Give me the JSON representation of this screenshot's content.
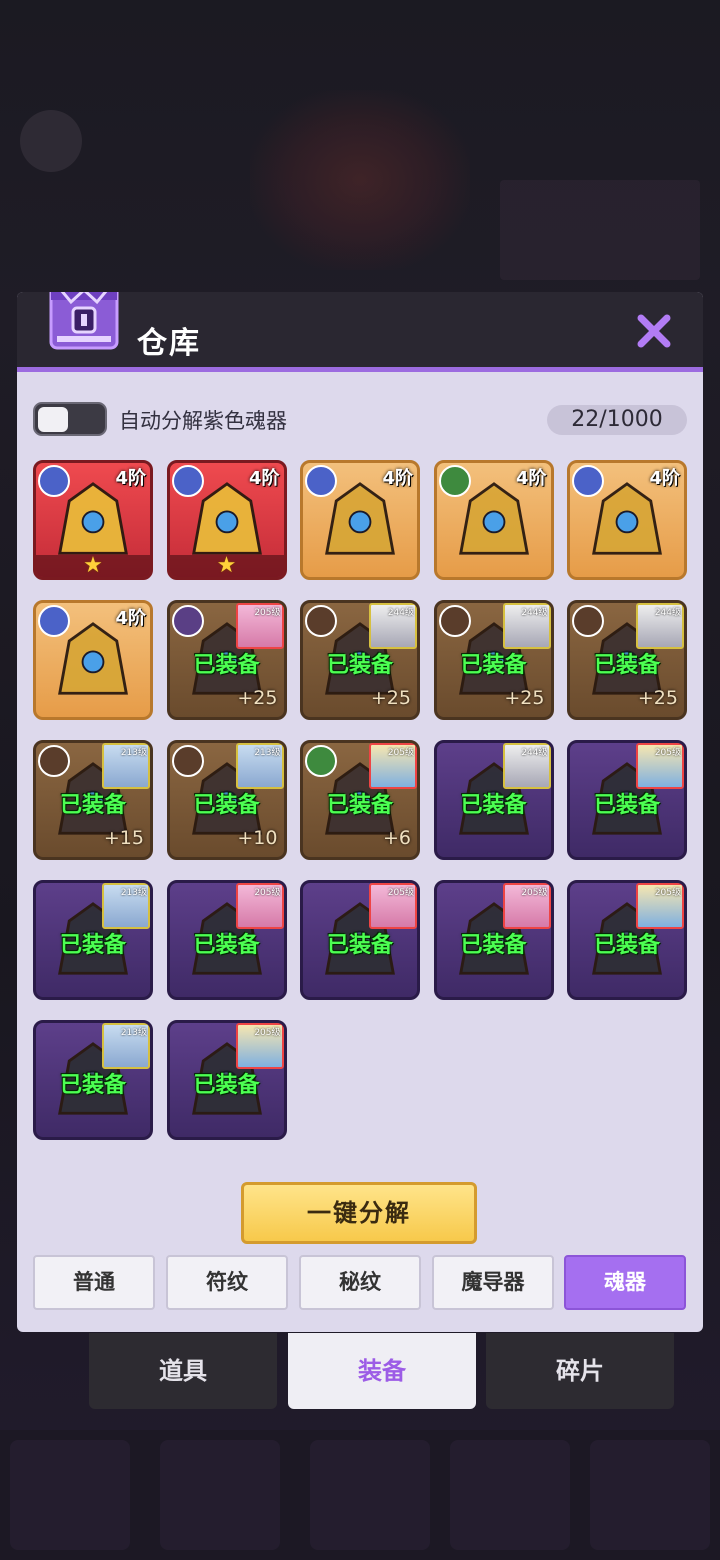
{
  "header": {
    "title": "仓库"
  },
  "toggle": {
    "label": "自动分解紫色魂器",
    "on": false
  },
  "capacity": "22/1000",
  "items": [
    {
      "tier": "4阶",
      "bg": "red",
      "badge": "blue",
      "star": true
    },
    {
      "tier": "4阶",
      "bg": "red",
      "badge": "blue",
      "star": true
    },
    {
      "tier": "4阶",
      "bg": "orange",
      "badge": "blue"
    },
    {
      "tier": "4阶",
      "bg": "orange",
      "badge": "green"
    },
    {
      "tier": "4阶",
      "bg": "orange",
      "badge": "blue"
    },
    {
      "tier": "4阶",
      "bg": "orange",
      "badge": "blue"
    },
    {
      "bg": "brown",
      "badge": "violet",
      "equipped": "已装备",
      "enh": "+25",
      "hero_level": "205级",
      "hero": "pink"
    },
    {
      "bg": "brown",
      "badge": "dark",
      "equipped": "已装备",
      "enh": "+25",
      "hero_level": "244级",
      "hero": "white"
    },
    {
      "bg": "brown",
      "badge": "dark",
      "equipped": "已装备",
      "enh": "+25",
      "hero_level": "244级",
      "hero": "white"
    },
    {
      "bg": "brown",
      "badge": "dark",
      "equipped": "已装备",
      "enh": "+25",
      "hero_level": "244级",
      "hero": "white"
    },
    {
      "bg": "brown",
      "badge": "dark",
      "equipped": "已装备",
      "enh": "+15",
      "hero_level": "213级",
      "hero": "blue"
    },
    {
      "bg": "brown",
      "badge": "dark",
      "equipped": "已装备",
      "enh": "+10",
      "hero_level": "213级",
      "hero": "blue"
    },
    {
      "bg": "brown",
      "badge": "green",
      "equipped": "已装备",
      "enh": "+6",
      "hero_level": "205级",
      "hero": "blonde"
    },
    {
      "bg": "purple",
      "equipped": "已装备",
      "hero_level": "244级",
      "hero": "white"
    },
    {
      "bg": "purple",
      "equipped": "已装备",
      "hero_level": "205级",
      "hero": "blonde"
    },
    {
      "bg": "purple",
      "equipped": "已装备",
      "hero_level": "213级",
      "hero": "blue"
    },
    {
      "bg": "purple",
      "equipped": "已装备",
      "hero_level": "205级",
      "hero": "pink"
    },
    {
      "bg": "purple",
      "equipped": "已装备",
      "hero_level": "205级",
      "hero": "pink"
    },
    {
      "bg": "purple",
      "equipped": "已装备",
      "hero_level": "205级",
      "hero": "pink"
    },
    {
      "bg": "purple",
      "equipped": "已装备",
      "hero_level": "205级",
      "hero": "blonde"
    },
    {
      "bg": "purple",
      "equipped": "已装备",
      "hero_level": "213级",
      "hero": "blue"
    },
    {
      "bg": "purple",
      "equipped": "已装备",
      "hero_level": "205级",
      "hero": "blonde"
    }
  ],
  "decompose_button": "一键分解",
  "filters": [
    {
      "label": "普通",
      "active": false
    },
    {
      "label": "符纹",
      "active": false
    },
    {
      "label": "秘纹",
      "active": false
    },
    {
      "label": "魔导器",
      "active": false
    },
    {
      "label": "魂器",
      "active": true
    }
  ],
  "main_tabs": [
    {
      "label": "道具",
      "active": false
    },
    {
      "label": "装备",
      "active": true
    },
    {
      "label": "碎片",
      "active": false
    }
  ],
  "colors": {
    "accent": "#a56ff0",
    "header": "#2a2731",
    "panel": "#ddd9ec",
    "equipped_text": "#4cff52"
  }
}
